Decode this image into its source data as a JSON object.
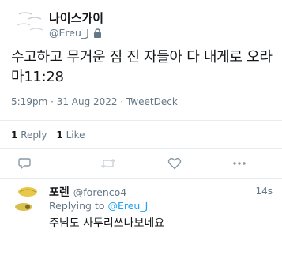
{
  "author": {
    "display_name": "나이스가이",
    "handle": "@Ereu_J"
  },
  "tweet": {
    "text": "수고하고 무거운 짐 진 자들아 다 내게로 오라 마11:28",
    "meta": "5:19pm · 31 Aug 2022 · TweetDeck"
  },
  "stats": {
    "reply_count": "1",
    "reply_label": "Reply",
    "like_count": "1",
    "like_label": "Like"
  },
  "actions": {
    "reply_icon": "reply-icon",
    "retweet_icon": "retweet-icon",
    "like_icon": "heart-icon",
    "more_icon": "more-icon"
  },
  "reply_tweet": {
    "display_name": "포렌",
    "handle": "@forenco4",
    "time": "14s",
    "replying_prefix": "Replying to",
    "replying_to": "@Ereu_J",
    "text": "주님도 사투리쓰나보네요"
  },
  "colors": {
    "text": "#14171a",
    "secondary": "#657786",
    "link": "#1da1f2",
    "divider": "#e6ecf0",
    "avatar_yellow": "#e8c84a"
  }
}
